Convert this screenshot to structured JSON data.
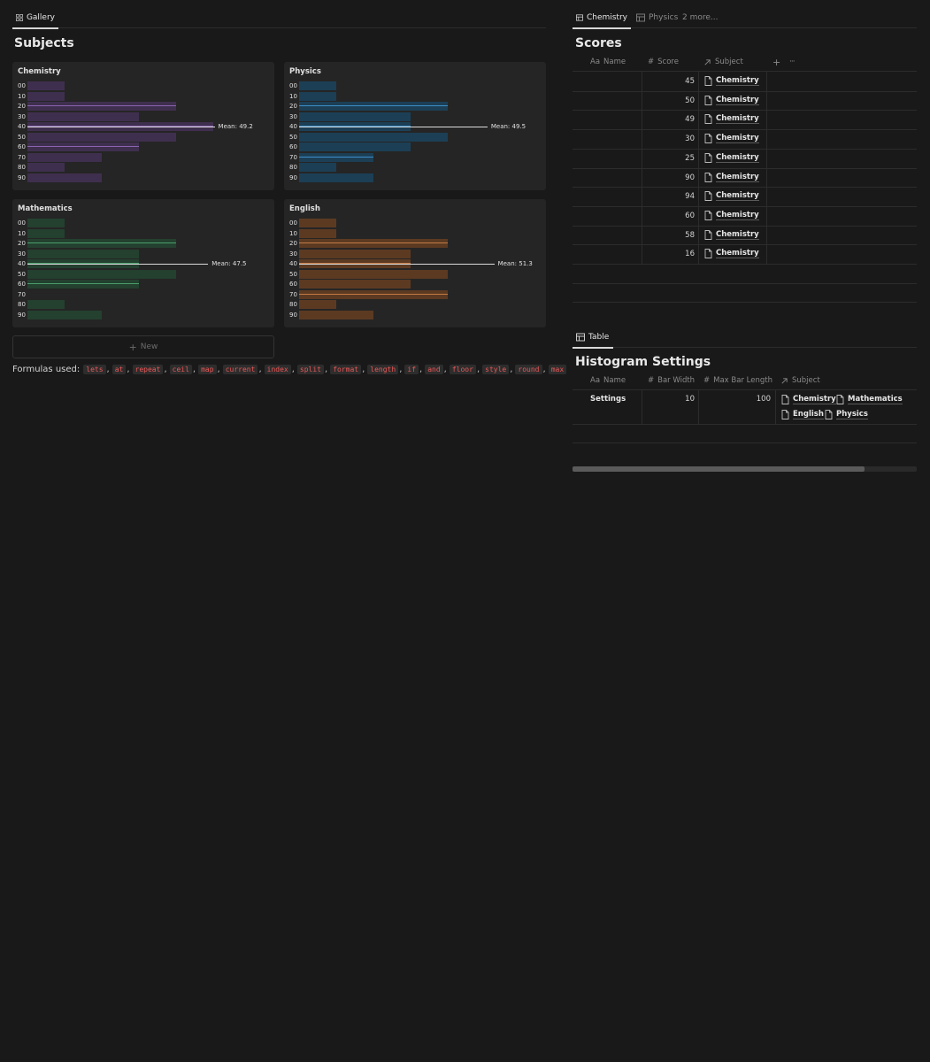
{
  "colors": {
    "background": "#191919",
    "card": "#252525",
    "chemistry_bar": "#3f2f4e",
    "chemistry_line": "#8a64b0",
    "physics_bar": "#1c3f56",
    "physics_line": "#3d8ec7",
    "mathematics_bar": "#24402f",
    "mathematics_line": "#4a9e6b",
    "english_bar": "#5c3a22",
    "english_line": "#c27a44",
    "code_text": "#eb5757"
  },
  "left": {
    "tab": {
      "label": "Gallery",
      "icon": "gallery-icon"
    },
    "title": "Subjects",
    "new_label": "New",
    "formulas_label": "Formulas used:",
    "formulas": [
      "lets",
      "at",
      "repeat",
      "ceil",
      "map",
      "current",
      "index",
      "split",
      "format",
      "length",
      "if",
      "and",
      "floor",
      "style",
      "round",
      "max"
    ]
  },
  "chart_data": [
    {
      "type": "bar",
      "title": "Chemistry",
      "orientation": "horizontal",
      "categories": [
        "00",
        "10",
        "20",
        "30",
        "40",
        "50",
        "60",
        "70",
        "80",
        "90"
      ],
      "values": [
        1,
        1,
        4,
        3,
        5,
        4,
        3,
        2,
        1,
        2
      ],
      "highlighted_bins": [
        "20",
        "40",
        "60"
      ],
      "mean_label": "Mean: 49.2",
      "mean": 49.2
    },
    {
      "type": "bar",
      "title": "Physics",
      "orientation": "horizontal",
      "categories": [
        "00",
        "10",
        "20",
        "30",
        "40",
        "50",
        "60",
        "70",
        "80",
        "90"
      ],
      "values": [
        1,
        1,
        4,
        3,
        3,
        4,
        3,
        2,
        1,
        2
      ],
      "highlighted_bins": [
        "20",
        "40",
        "70"
      ],
      "mean_label": "Mean: 49.5",
      "mean": 49.5
    },
    {
      "type": "bar",
      "title": "Mathematics",
      "orientation": "horizontal",
      "categories": [
        "00",
        "10",
        "20",
        "30",
        "40",
        "50",
        "60",
        "70",
        "80",
        "90"
      ],
      "values": [
        1,
        1,
        4,
        3,
        3,
        4,
        3,
        0,
        1,
        2
      ],
      "highlighted_bins": [
        "20",
        "40",
        "60"
      ],
      "mean_label": "Mean: 47.5",
      "mean": 47.5
    },
    {
      "type": "bar",
      "title": "English",
      "orientation": "horizontal",
      "categories": [
        "00",
        "10",
        "20",
        "30",
        "40",
        "50",
        "60",
        "70",
        "80",
        "90"
      ],
      "values": [
        1,
        1,
        4,
        3,
        3,
        4,
        3,
        4,
        1,
        2
      ],
      "highlighted_bins": [
        "20",
        "40",
        "70"
      ],
      "mean_label": "Mean: 51.3",
      "mean": 51.3
    }
  ],
  "scores": {
    "tabs": [
      {
        "label": "Chemistry",
        "icon": "table-icon",
        "active": true
      },
      {
        "label": "Physics",
        "icon": "table-icon",
        "active": false
      },
      {
        "label": "2 more...",
        "icon": "",
        "active": false
      }
    ],
    "title": "Scores",
    "columns": {
      "name": "Name",
      "name_prefix": "Aa",
      "score": "Score",
      "subject": "Subject"
    },
    "rows": [
      {
        "score": "45",
        "subject": "Chemistry"
      },
      {
        "score": "50",
        "subject": "Chemistry"
      },
      {
        "score": "49",
        "subject": "Chemistry"
      },
      {
        "score": "30",
        "subject": "Chemistry"
      },
      {
        "score": "25",
        "subject": "Chemistry"
      },
      {
        "score": "90",
        "subject": "Chemistry"
      },
      {
        "score": "94",
        "subject": "Chemistry"
      },
      {
        "score": "60",
        "subject": "Chemistry"
      },
      {
        "score": "58",
        "subject": "Chemistry"
      },
      {
        "score": "16",
        "subject": "Chemistry"
      }
    ],
    "add_column_symbol": "+",
    "more_symbol": "···"
  },
  "settings": {
    "tab": {
      "label": "Table",
      "icon": "table-icon"
    },
    "title": "Histogram Settings",
    "columns": {
      "name": "Name",
      "name_prefix": "Aa",
      "bar_width": "Bar Width",
      "max_bar_length": "Max Bar Length",
      "subject": "Subject"
    },
    "row": {
      "name": "Settings",
      "bar_width": "10",
      "max_bar_length": "100",
      "subjects": [
        "Chemistry",
        "Mathematics",
        "English",
        "Physics"
      ]
    }
  }
}
